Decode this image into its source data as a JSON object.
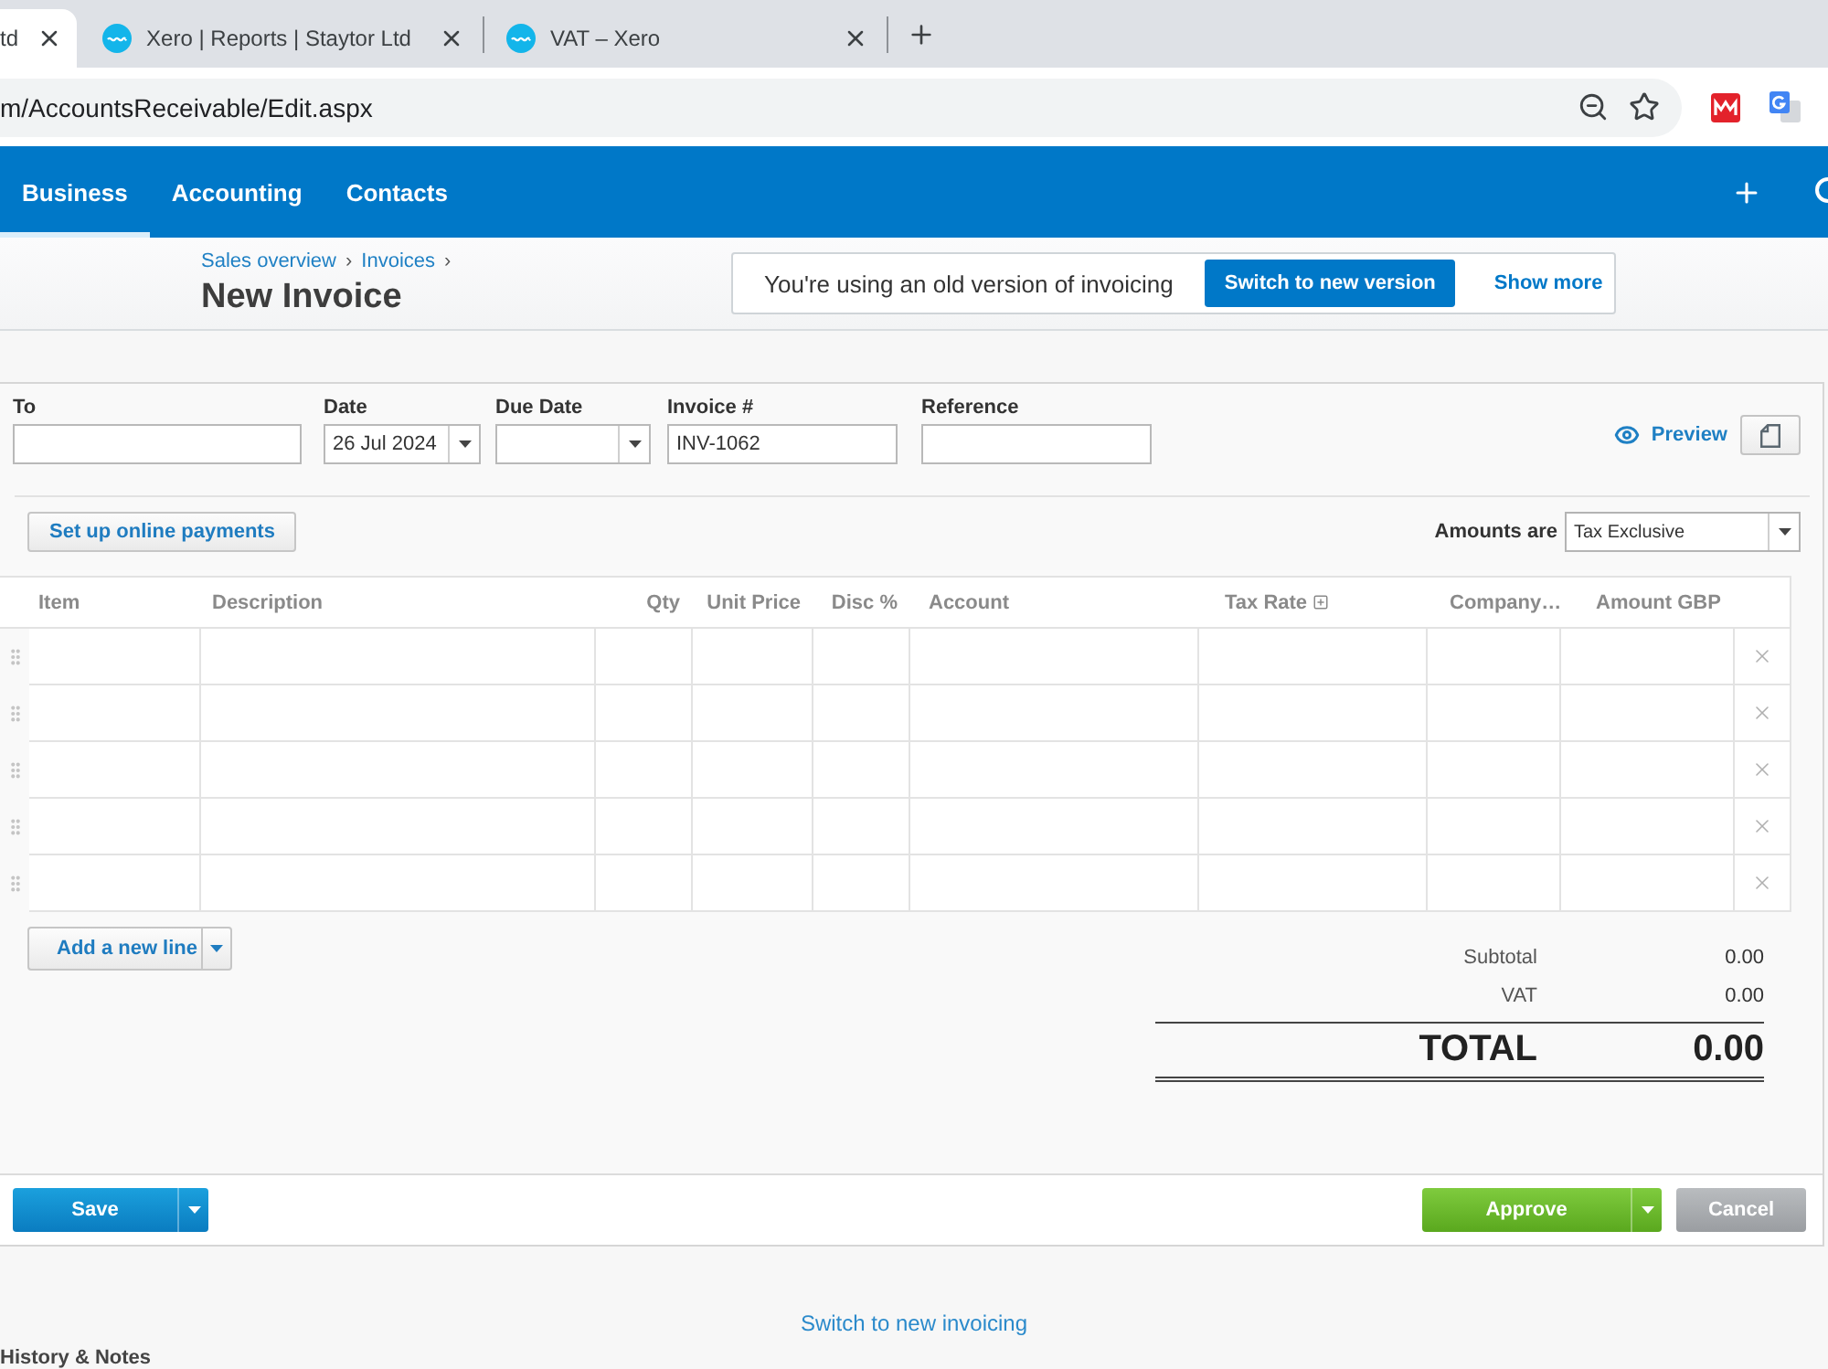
{
  "browser": {
    "tabs": [
      {
        "title": "td",
        "selected": true,
        "favicon": false
      },
      {
        "title": "Xero | Reports | Staytor Ltd",
        "selected": false,
        "favicon": true
      },
      {
        "title": "VAT – Xero",
        "selected": false,
        "favicon": true
      }
    ],
    "address": "m/AccountsReceivable/Edit.aspx"
  },
  "nav": {
    "items": [
      {
        "label": "Business",
        "selected": true
      },
      {
        "label": "Accounting",
        "selected": false
      },
      {
        "label": "Contacts",
        "selected": false
      }
    ]
  },
  "header": {
    "breadcrumb": [
      "Sales overview",
      "Invoices"
    ],
    "separator": "›",
    "title": "New Invoice"
  },
  "notice": {
    "message": "You're using an old version of invoicing",
    "button": "Switch to new version",
    "link": "Show more"
  },
  "form": {
    "fields": [
      {
        "label": "To",
        "kind": "text"
      },
      {
        "label": "Date",
        "kind": "date",
        "value": "26 Jul 2024"
      },
      {
        "label": "Due Date",
        "kind": "date"
      },
      {
        "label": "Invoice #",
        "kind": "text",
        "value": "INV-1062"
      },
      {
        "label": "Reference",
        "kind": "text"
      }
    ],
    "preview": "Preview",
    "payments_button": "Set up online payments",
    "amounts": {
      "label": "Amounts are",
      "value": "Tax Exclusive"
    }
  },
  "table": {
    "columns": [
      {
        "label": "Item",
        "kind": "plain"
      },
      {
        "label": "Description",
        "kind": "plain"
      },
      {
        "label": "Qty",
        "kind": "plain"
      },
      {
        "label": "Unit Price",
        "kind": "plain"
      },
      {
        "label": "Disc %",
        "kind": "plain"
      },
      {
        "label": "Account",
        "kind": "plain"
      },
      {
        "label": "Tax Rate",
        "kind": "toggle"
      },
      {
        "label": "Company…",
        "kind": "plain"
      },
      {
        "label": "Amount GBP",
        "kind": "plain"
      }
    ],
    "rows": [
      {
        "kind": "empty"
      },
      {
        "kind": "empty"
      },
      {
        "kind": "empty"
      },
      {
        "kind": "empty"
      },
      {
        "kind": "empty"
      }
    ]
  },
  "add_line_button": "Add a new line",
  "totals": {
    "lines": [
      {
        "label": "Subtotal",
        "value": "0.00"
      },
      {
        "label": "VAT",
        "value": "0.00"
      }
    ],
    "total": {
      "label": "TOTAL",
      "value": "0.00"
    }
  },
  "actions": [
    {
      "label": "Save",
      "kind": "save"
    },
    {
      "label": "Approve",
      "kind": "approve"
    },
    {
      "label": "Cancel",
      "kind": "cancel"
    }
  ],
  "switch_link": "Switch to new invoicing",
  "history_heading": "History & Notes"
}
